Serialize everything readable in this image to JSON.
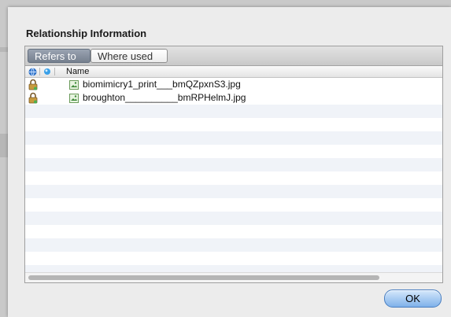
{
  "dialog": {
    "title": "Relationship Information",
    "ok_label": "OK"
  },
  "tabs": [
    {
      "label": "Refers to",
      "active": true
    },
    {
      "label": "Where used",
      "active": false
    }
  ],
  "columns": [
    {
      "icon": "globe-icon"
    },
    {
      "icon": "status-dot-icon"
    },
    {
      "label": "Name"
    }
  ],
  "rows": [
    {
      "name": "biomimicry1_print___bmQZpxnS3.jpg",
      "status_icon": "lock-icon",
      "file_icon": "image-file-icon"
    },
    {
      "name": "broughton__________bmRPHelmJ.jpg",
      "status_icon": "lock-icon",
      "file_icon": "image-file-icon"
    }
  ],
  "colors": {
    "active_tab": "#76808f",
    "row_stripe": "#f0f3f8",
    "ok_button": "#7fb1ea"
  }
}
